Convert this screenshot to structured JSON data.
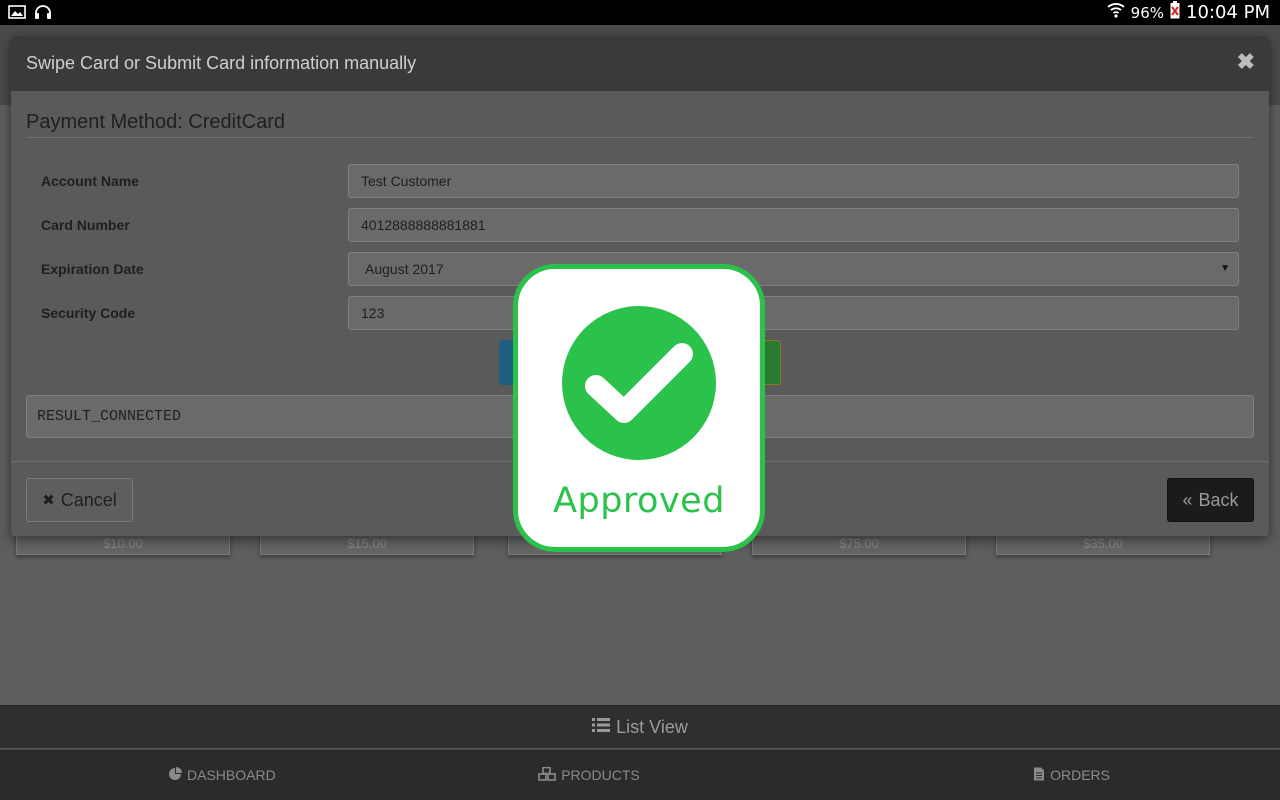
{
  "status_bar": {
    "battery_percent": "96%",
    "time": "10:04 PM",
    "icons": [
      "image-icon",
      "headphones-icon",
      "wifi-icon",
      "battery-icon"
    ]
  },
  "modal": {
    "title": "Swipe Card or Submit Card information manually",
    "payment_method_title": "Payment Method: CreditCard",
    "fields": [
      {
        "label": "Account Name",
        "value": "Test Customer"
      },
      {
        "label": "Card Number",
        "value": "4012888888881881"
      },
      {
        "label": "Expiration Date",
        "value": "August 2017"
      },
      {
        "label": "Security Code",
        "value": "123"
      }
    ],
    "result_text": "RESULT_CONNECTED",
    "cancel_label": "Cancel",
    "back_label": "Back"
  },
  "approved": {
    "label": "Approved",
    "color": "#2bc24b"
  },
  "background": {
    "card_prices": [
      "$10.00",
      "$15.00",
      "",
      "$75.00",
      "$35.00"
    ],
    "list_view_label": "List View"
  },
  "bottom_nav": {
    "items": [
      {
        "label": "DASHBOARD",
        "icon": "pie-chart-icon"
      },
      {
        "label": "PRODUCTS",
        "icon": "cubes-icon"
      },
      {
        "label": "ORDERS",
        "icon": "file-icon"
      }
    ]
  }
}
